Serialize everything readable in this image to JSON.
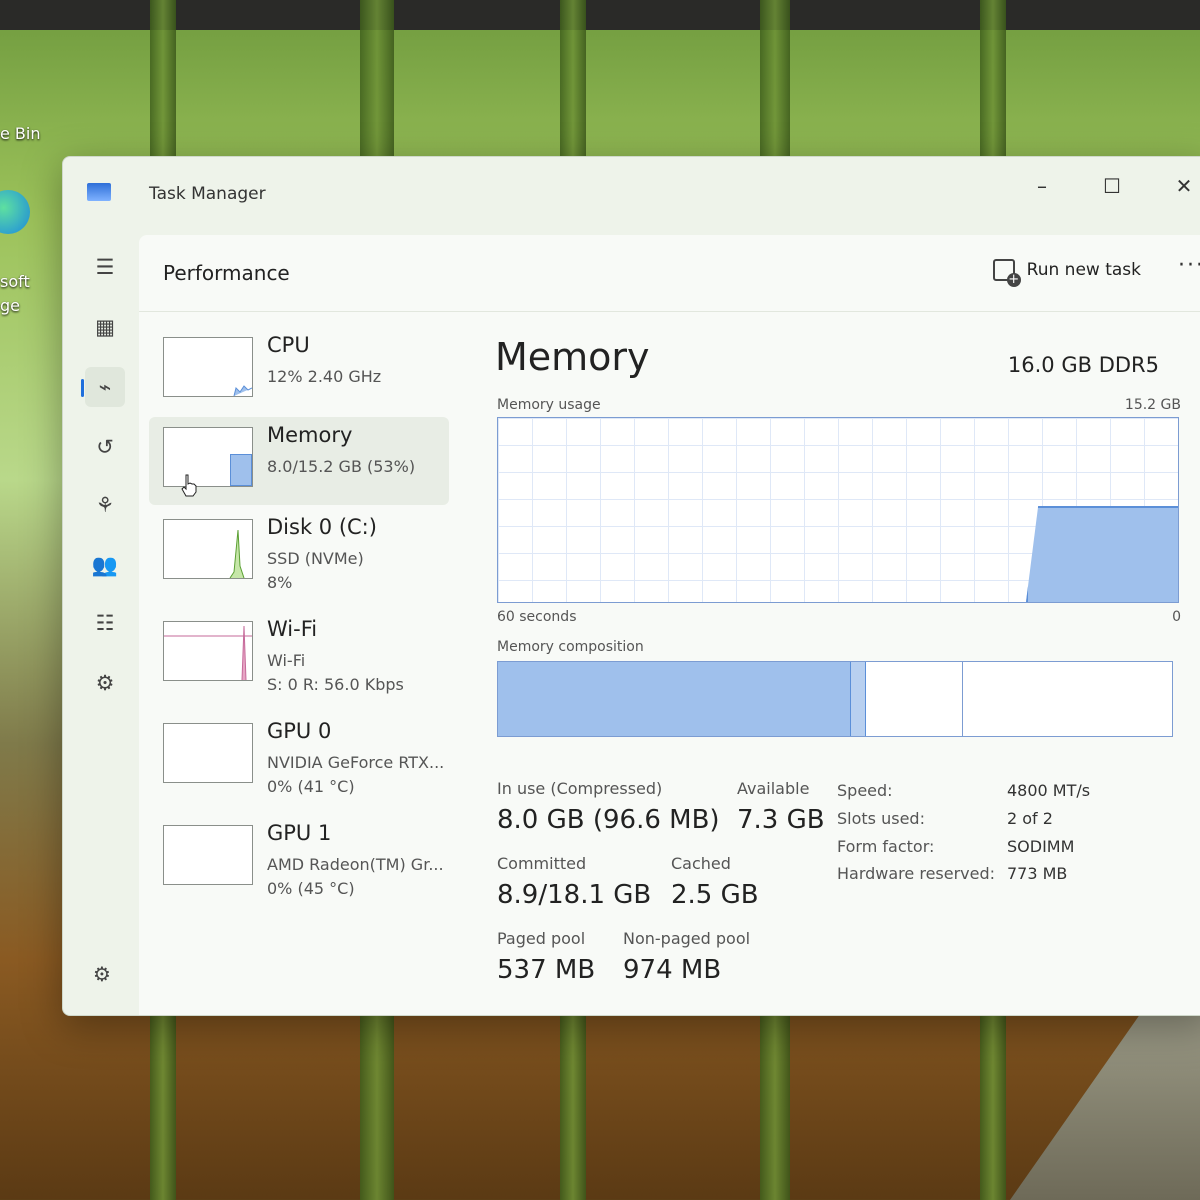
{
  "desktop": {
    "recycle_bin_label": "e Bin",
    "edge_label_line1": "soft",
    "edge_label_line2": "ge"
  },
  "window": {
    "title": "Task Manager",
    "controls": {
      "minimize": "–",
      "maximize": "☐",
      "close": "✕"
    }
  },
  "header": {
    "page_title": "Performance",
    "run_new_task": "Run new task",
    "more": "···"
  },
  "nav": {
    "items": [
      {
        "name": "hamburger-menu-icon",
        "glyph": "☰"
      },
      {
        "name": "processes-icon",
        "glyph": "▦"
      },
      {
        "name": "performance-icon",
        "glyph": "⌁"
      },
      {
        "name": "app-history-icon",
        "glyph": "↺"
      },
      {
        "name": "startup-apps-icon",
        "glyph": "⚘"
      },
      {
        "name": "users-icon",
        "glyph": "👥"
      },
      {
        "name": "details-icon",
        "glyph": "☷"
      },
      {
        "name": "services-icon",
        "glyph": "⚙"
      }
    ],
    "settings_glyph": "⚙"
  },
  "devices": [
    {
      "name": "CPU",
      "sub1": "12%  2.40 GHz",
      "sub2": ""
    },
    {
      "name": "Memory",
      "sub1": "8.0/15.2 GB (53%)",
      "sub2": ""
    },
    {
      "name": "Disk 0 (C:)",
      "sub1": "SSD (NVMe)",
      "sub2": "8%"
    },
    {
      "name": "Wi-Fi",
      "sub1": "Wi-Fi",
      "sub2": "S: 0  R: 56.0 Kbps"
    },
    {
      "name": "GPU 0",
      "sub1": "NVIDIA GeForce RTX...",
      "sub2": "0%  (41 °C)"
    },
    {
      "name": "GPU 1",
      "sub1": "AMD Radeon(TM) Gr...",
      "sub2": "0%  (45 °C)"
    }
  ],
  "memory": {
    "title": "Memory",
    "spec": "16.0 GB DDR5",
    "usage_label": "Memory usage",
    "usage_max": "15.2 GB",
    "time_label_left": "60 seconds",
    "time_label_right": "0",
    "composition_label": "Memory composition",
    "stats": {
      "in_use_label": "In use (Compressed)",
      "in_use_value": "8.0 GB (96.6 MB)",
      "available_label": "Available",
      "available_value": "7.3 GB",
      "committed_label": "Committed",
      "committed_value": "8.9/18.1 GB",
      "cached_label": "Cached",
      "cached_value": "2.5 GB",
      "paged_label": "Paged pool",
      "paged_value": "537 MB",
      "nonpaged_label": "Non-paged pool",
      "nonpaged_value": "974 MB"
    },
    "specs": [
      {
        "label": "Speed:",
        "value": "4800 MT/s"
      },
      {
        "label": "Slots used:",
        "value": "2 of 2"
      },
      {
        "label": "Form factor:",
        "value": "SODIMM"
      },
      {
        "label": "Hardware reserved:",
        "value": "773 MB"
      }
    ]
  },
  "colors": {
    "accent": "#1f6fdc",
    "memory_fill": "#9fc0ec",
    "graph_border": "#7c9cd2"
  }
}
